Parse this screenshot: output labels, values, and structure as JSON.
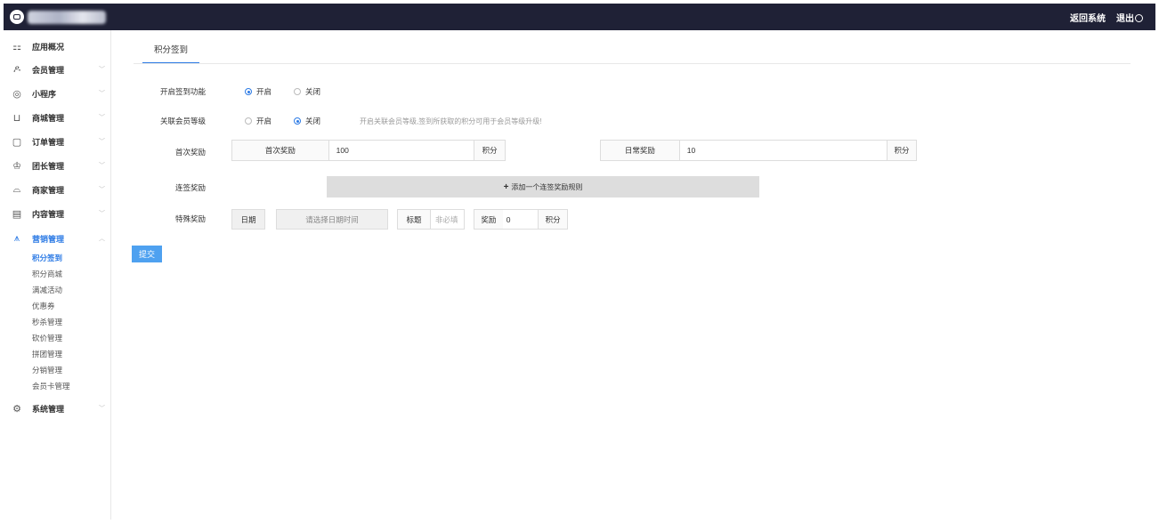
{
  "header": {
    "return_label": "返回系统",
    "logout_label": "退出",
    "logout_icon": "logout-icon"
  },
  "sidebar": {
    "items": [
      {
        "label": "应用概况",
        "icon": "grid-icon"
      },
      {
        "label": "会员管理",
        "icon": "users-icon"
      },
      {
        "label": "小程序",
        "icon": "miniprogram-icon"
      },
      {
        "label": "商城管理",
        "icon": "cart-icon"
      },
      {
        "label": "订单管理",
        "icon": "order-icon"
      },
      {
        "label": "团长管理",
        "icon": "crown-icon"
      },
      {
        "label": "商家管理",
        "icon": "shop-icon"
      },
      {
        "label": "内容管理",
        "icon": "document-icon"
      },
      {
        "label": "营销管理",
        "icon": "marketing-icon"
      },
      {
        "label": "系统管理",
        "icon": "settings-icon"
      }
    ],
    "marketing_sub": [
      "积分签到",
      "积分商城",
      "满减活动",
      "优惠券",
      "秒杀管理",
      "砍价管理",
      "拼团管理",
      "分销管理",
      "会员卡管理"
    ]
  },
  "tab": {
    "label": "积分签到"
  },
  "form": {
    "enable_label": "开启签到功能",
    "enable_on": "开启",
    "enable_off": "关闭",
    "member_label": "关联会员等级",
    "member_on": "开启",
    "member_off": "关闭",
    "member_hint": "开启关联会员等级,签到所获取的积分可用于会员等级升级!",
    "first_label": "首次奖励",
    "first_addon": "首次奖励",
    "first_value": "100",
    "first_unit": "积分",
    "daily_addon": "日常奖励",
    "daily_value": "10",
    "daily_unit": "积分",
    "streak_label": "连签奖励",
    "add_rule": "添加一个连签奖励规则",
    "special_label": "特殊奖励",
    "date_addon": "日期",
    "date_placeholder": "请选择日期时间",
    "title_addon": "标题",
    "title_placeholder": "非必填",
    "reward_addon": "奖励",
    "reward_value": "0",
    "reward_unit": "积分",
    "submit_label": "提交"
  }
}
